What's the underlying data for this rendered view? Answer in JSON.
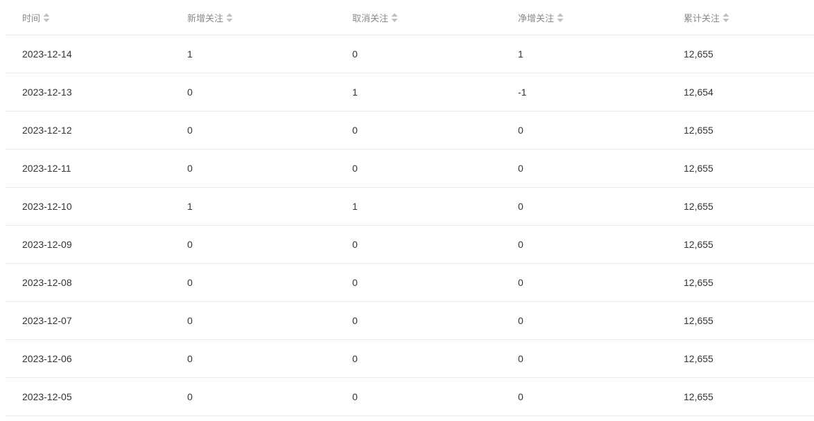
{
  "table": {
    "columns": [
      {
        "label": "时间"
      },
      {
        "label": "新增关注"
      },
      {
        "label": "取消关注"
      },
      {
        "label": "净增关注"
      },
      {
        "label": "累计关注"
      }
    ],
    "rows": [
      [
        "2023-12-14",
        "1",
        "0",
        "1",
        "12,655"
      ],
      [
        "2023-12-13",
        "0",
        "1",
        "-1",
        "12,654"
      ],
      [
        "2023-12-12",
        "0",
        "0",
        "0",
        "12,655"
      ],
      [
        "2023-12-11",
        "0",
        "0",
        "0",
        "12,655"
      ],
      [
        "2023-12-10",
        "1",
        "1",
        "0",
        "12,655"
      ],
      [
        "2023-12-09",
        "0",
        "0",
        "0",
        "12,655"
      ],
      [
        "2023-12-08",
        "0",
        "0",
        "0",
        "12,655"
      ],
      [
        "2023-12-07",
        "0",
        "0",
        "0",
        "12,655"
      ],
      [
        "2023-12-06",
        "0",
        "0",
        "0",
        "12,655"
      ],
      [
        "2023-12-05",
        "0",
        "0",
        "0",
        "12,655"
      ]
    ],
    "sort_icon": "sort-updown-icon",
    "colors": {
      "header_text": "#8a8a8a",
      "body_text": "#333333",
      "divider": "#e8e8e8",
      "sort_icon": "#c0c0c0"
    }
  }
}
